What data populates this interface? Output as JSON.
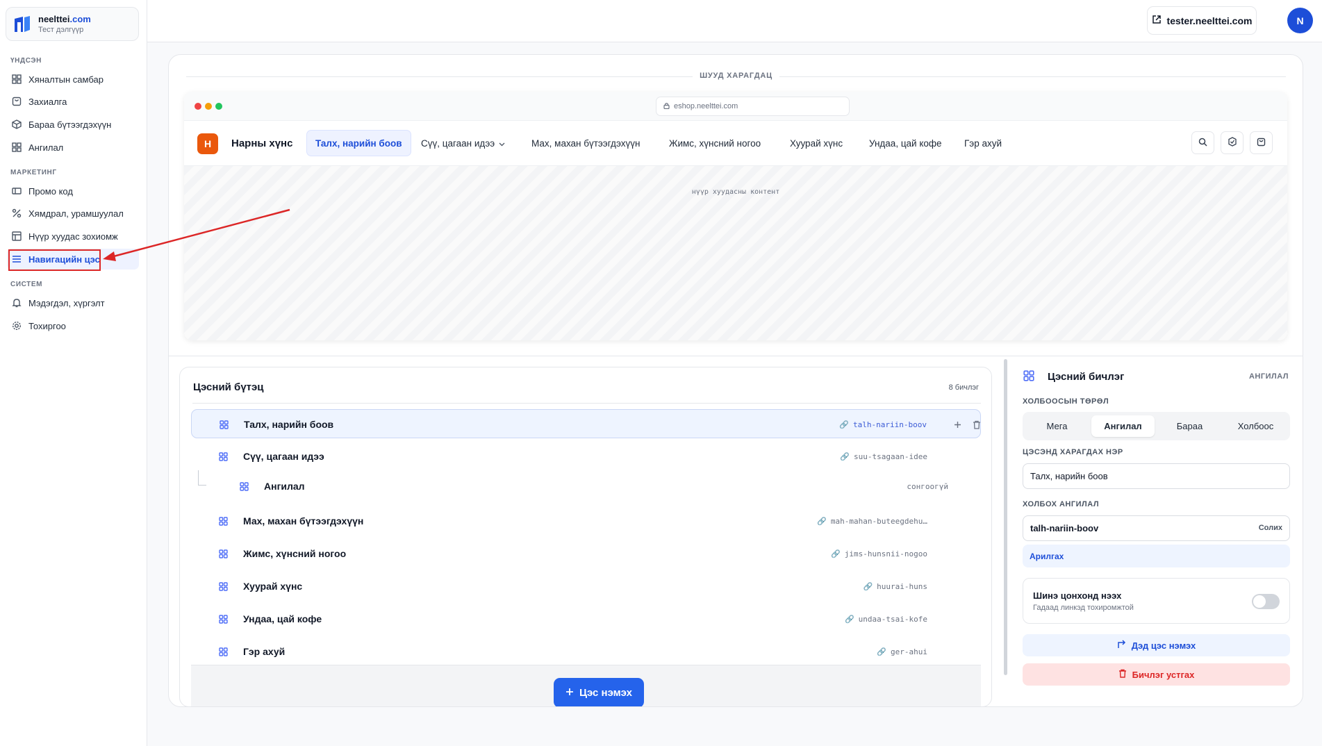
{
  "brand": {
    "name": "neelttei",
    "domain": ".com",
    "subtitle": "Тест дэлгүүр"
  },
  "sidebar": {
    "sections": [
      {
        "label": "ҮНДСЭН"
      },
      {
        "label": "МАРКЕТИНГ"
      },
      {
        "label": "СИСТЕМ"
      }
    ],
    "items": [
      {
        "label": "Хяналтын самбар",
        "icon": "grid-icon"
      },
      {
        "label": "Захиалга",
        "icon": "bag-icon"
      },
      {
        "label": "Бараа бүтээгдэхүүн",
        "icon": "box-icon"
      },
      {
        "label": "Ангилал",
        "icon": "grid-icon"
      },
      {
        "label": "Промо код",
        "icon": "ticket-icon"
      },
      {
        "label": "Хямдрал, урамшуулал",
        "icon": "percent-icon"
      },
      {
        "label": "Нүүр хуудас зохиомж",
        "icon": "layout-icon"
      },
      {
        "label": "Навигацийн цэс",
        "icon": "menu-icon",
        "active": true
      },
      {
        "label": "Мэдэгдэл, хүргэлт",
        "icon": "bell-icon"
      },
      {
        "label": "Тохиргоо",
        "icon": "gear-icon"
      }
    ]
  },
  "header": {
    "store_link": "tester.neelttei.com",
    "avatar_initial": "N"
  },
  "preview": {
    "label": "ШУУД ХАРАГДАЦ",
    "url": "eshop.neelttei.com",
    "site_logo_initial": "Н",
    "site_name": "Нарны хүнс",
    "tabs": [
      {
        "label": "Талх, нарийн боов",
        "active": true
      },
      {
        "label": "Сүү, цагаан идээ",
        "dropdown": true
      },
      {
        "label": "Мах, махан бүтээгдэхүүн"
      },
      {
        "label": "Жимс, хүнсний ногоо"
      },
      {
        "label": "Хуурай хүнс"
      },
      {
        "label": "Ундаа, цай кофе"
      },
      {
        "label": "Гэр ахуй"
      }
    ],
    "content_label": "нүүр хуудасны контент"
  },
  "tree": {
    "title": "Цэсний бүтэц",
    "count": "8 бичлэг",
    "rows": [
      {
        "label": "Талх, нарийн боов",
        "slug": "talh-nariin-boov",
        "selected": true
      },
      {
        "label": "Сүү, цагаан идээ",
        "slug": "suu-tsagaan-idee"
      },
      {
        "label": "Ангилал",
        "slug": "сонгоогүй",
        "child": true
      },
      {
        "label": "Мах, махан бүтээгдэхүүн",
        "slug": "mah-mahan-buteegdehu…"
      },
      {
        "label": "Жимс, хүнсний ногоо",
        "slug": "jims-hunsnii-nogoo"
      },
      {
        "label": "Хуурай хүнс",
        "slug": "huurai-huns"
      },
      {
        "label": "Ундаа, цай кофе",
        "slug": "undaa-tsai-kofe"
      },
      {
        "label": "Гэр ахуй",
        "slug": "ger-ahui"
      }
    ],
    "add_label": "Цэс нэмэх"
  },
  "editor": {
    "title": "Цэсний бичлэг",
    "type_badge": "АНГИЛАЛ",
    "link_type_label": "ХОЛБООСЫН ТӨРӨЛ",
    "link_types": [
      {
        "label": "Мега"
      },
      {
        "label": "Ангилал",
        "active": true
      },
      {
        "label": "Бараа"
      },
      {
        "label": "Холбоос"
      }
    ],
    "display_name_label": "ЦЭСЭНД ХАРАГДАХ НЭР",
    "display_name_value": "Талх, нарийн боов",
    "link_category_label": "ХОЛБОХ АНГИЛАЛ",
    "link_category_value": "talh-nariin-boov",
    "change_label": "Солих",
    "clear_label": "Арилгах",
    "new_window_title": "Шинэ цонхонд нээх",
    "new_window_sub": "Гадаад линкэд тохиромжтой",
    "add_sub_label": "Дэд цэс нэмэх",
    "delete_label": "Бичлэг устгах"
  },
  "colors": {
    "accent": "#2563eb",
    "danger": "#dc2626",
    "annotation": "#dc2626"
  }
}
